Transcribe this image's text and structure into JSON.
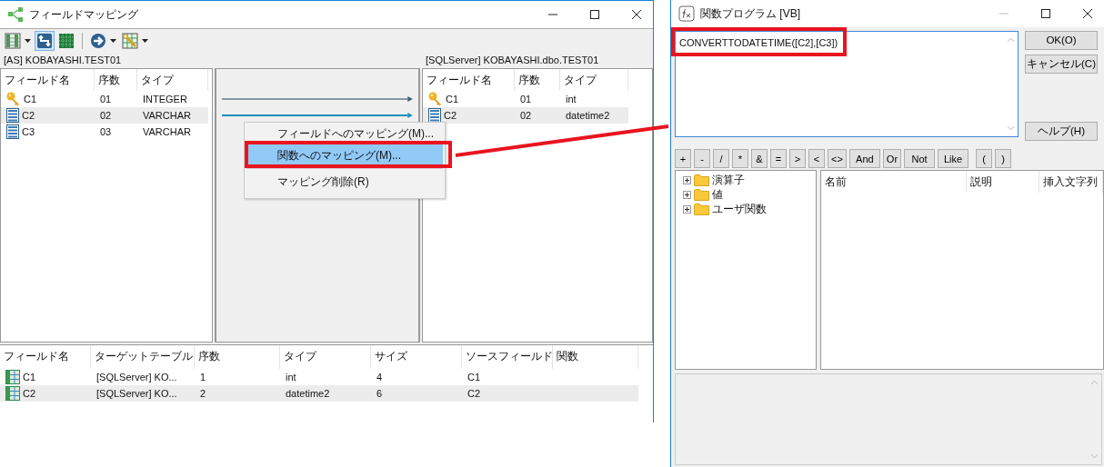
{
  "mapping_window": {
    "title": "フィールドマッピング",
    "toolbar": [
      {
        "kind": "columns",
        "dropdown": true,
        "selected": false
      },
      {
        "kind": "link",
        "dropdown": false,
        "selected": true
      },
      {
        "kind": "grid",
        "dropdown": false,
        "selected": false
      },
      {
        "kind": "go",
        "dropdown": true,
        "selected": false
      },
      {
        "kind": "wand",
        "dropdown": true,
        "selected": false
      }
    ],
    "source": {
      "title": "[AS] KOBAYASHI.TEST01",
      "columns": [
        "フィールド名",
        "序数",
        "タイプ"
      ],
      "rows": [
        {
          "kind": "key",
          "cells": [
            "C1",
            "01",
            "INTEGER"
          ],
          "selected": false
        },
        {
          "kind": "column",
          "cells": [
            "C2",
            "02",
            "VARCHAR"
          ],
          "selected": true
        },
        {
          "kind": "column",
          "cells": [
            "C3",
            "03",
            "VARCHAR"
          ],
          "selected": false
        }
      ]
    },
    "mappings": [
      {
        "selected": false
      },
      {
        "selected": true
      }
    ],
    "target": {
      "title": "[SQLServer] KOBAYASHI.dbo.TEST01",
      "columns": [
        "フィールド名",
        "序数",
        "タイプ"
      ],
      "rows": [
        {
          "kind": "key",
          "cells": [
            "C1",
            "01",
            "int"
          ],
          "selected": false
        },
        {
          "kind": "column",
          "cells": [
            "C2",
            "02",
            "datetime2"
          ],
          "selected": true
        }
      ]
    },
    "context_menu": [
      {
        "label": "フィールドへのマッピング(M)...",
        "selected": false
      },
      {
        "label": "関数へのマッピング(M)...",
        "selected": true
      },
      {
        "label": "マッピング削除(R)",
        "selected": false
      }
    ],
    "result_table": {
      "columns": [
        "フィールド名",
        "ターゲットテーブル",
        "序数",
        "タイプ",
        "サイズ",
        "ソースフィールド",
        "関数"
      ],
      "rows": [
        {
          "cells": [
            "C1",
            "[SQLServer] KO...",
            "1",
            "int",
            "4",
            "C1",
            ""
          ],
          "selected": false
        },
        {
          "cells": [
            "C2",
            "[SQLServer] KO...",
            "2",
            "datetime2",
            "6",
            "C2",
            ""
          ],
          "selected": true
        }
      ]
    }
  },
  "function_window": {
    "title": "関数プログラム [VB]",
    "expression": "CONVERTTODATETIME([C2],[C3])",
    "buttons": [
      "OK(O)",
      "キャンセル(C)",
      "ヘルプ(H)"
    ],
    "operators": [
      "+",
      "-",
      "/",
      "*",
      "&",
      "=",
      ">",
      "<",
      "<>",
      "And",
      "Or",
      "Not",
      "Like",
      "(",
      ")"
    ],
    "tree": [
      {
        "label": "演算子",
        "expanded": false
      },
      {
        "label": "値",
        "expanded": false
      },
      {
        "label": "ユーザ関数",
        "expanded": false
      }
    ],
    "list_columns": [
      "名前",
      "説明",
      "挿入文字列"
    ]
  }
}
